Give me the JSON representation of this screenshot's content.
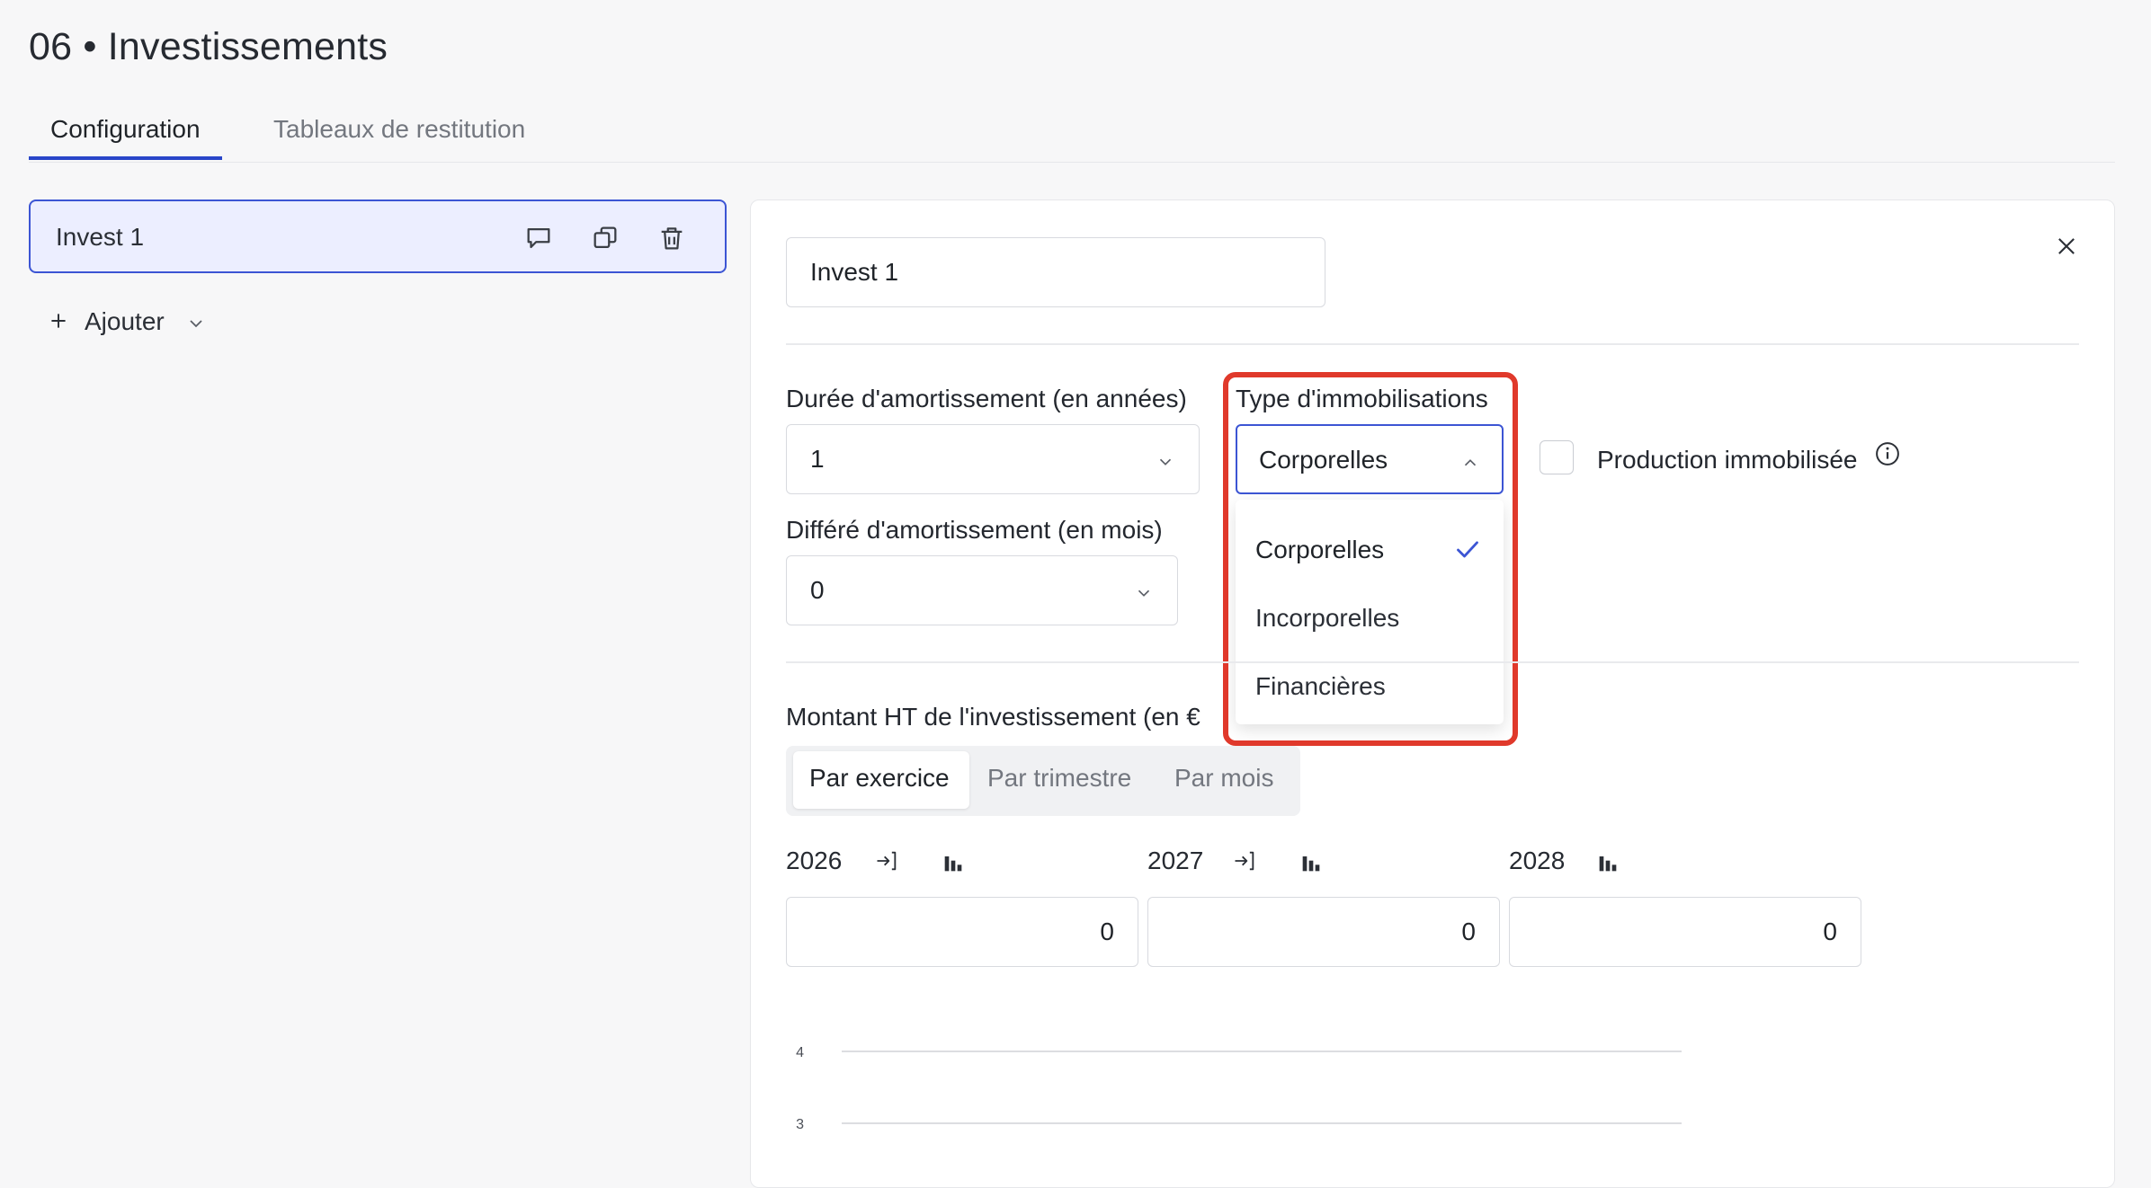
{
  "page": {
    "title": "06 • Investissements"
  },
  "tabs": [
    {
      "label": "Configuration",
      "active": true
    },
    {
      "label": "Tableaux de restitution",
      "active": false
    }
  ],
  "sidebar": {
    "items": [
      {
        "label": "Invest 1",
        "selected": true
      }
    ],
    "add_label": "Ajouter"
  },
  "form": {
    "name_value": "Invest 1",
    "duree": {
      "label": "Durée d'amortissement (en années)",
      "value": "1"
    },
    "differe": {
      "label": "Différé d'amortissement (en mois)",
      "value": "0"
    },
    "type": {
      "label": "Type d'immobilisations",
      "value": "Corporelles",
      "open": true,
      "options": [
        "Corporelles",
        "Incorporelles",
        "Financières"
      ],
      "selected_index": 0
    },
    "production": {
      "label": "Production immobilisée",
      "checked": false
    },
    "montant": {
      "label": "Montant HT de l'investissement (en €",
      "periods": [
        "Par exercice",
        "Par trimestre",
        "Par mois"
      ],
      "active_period": "Par exercice",
      "years": [
        {
          "year": "2026",
          "value": "0"
        },
        {
          "year": "2027",
          "value": "0"
        },
        {
          "year": "2028",
          "value": "0"
        }
      ]
    }
  },
  "chart_data": {
    "type": "bar",
    "categories": [],
    "values": [],
    "y_ticks": [
      "4",
      "3"
    ],
    "grid": true
  },
  "colors": {
    "accent": "#3c55d4",
    "highlight": "#e0392b",
    "selected_bg": "#eceeff"
  }
}
